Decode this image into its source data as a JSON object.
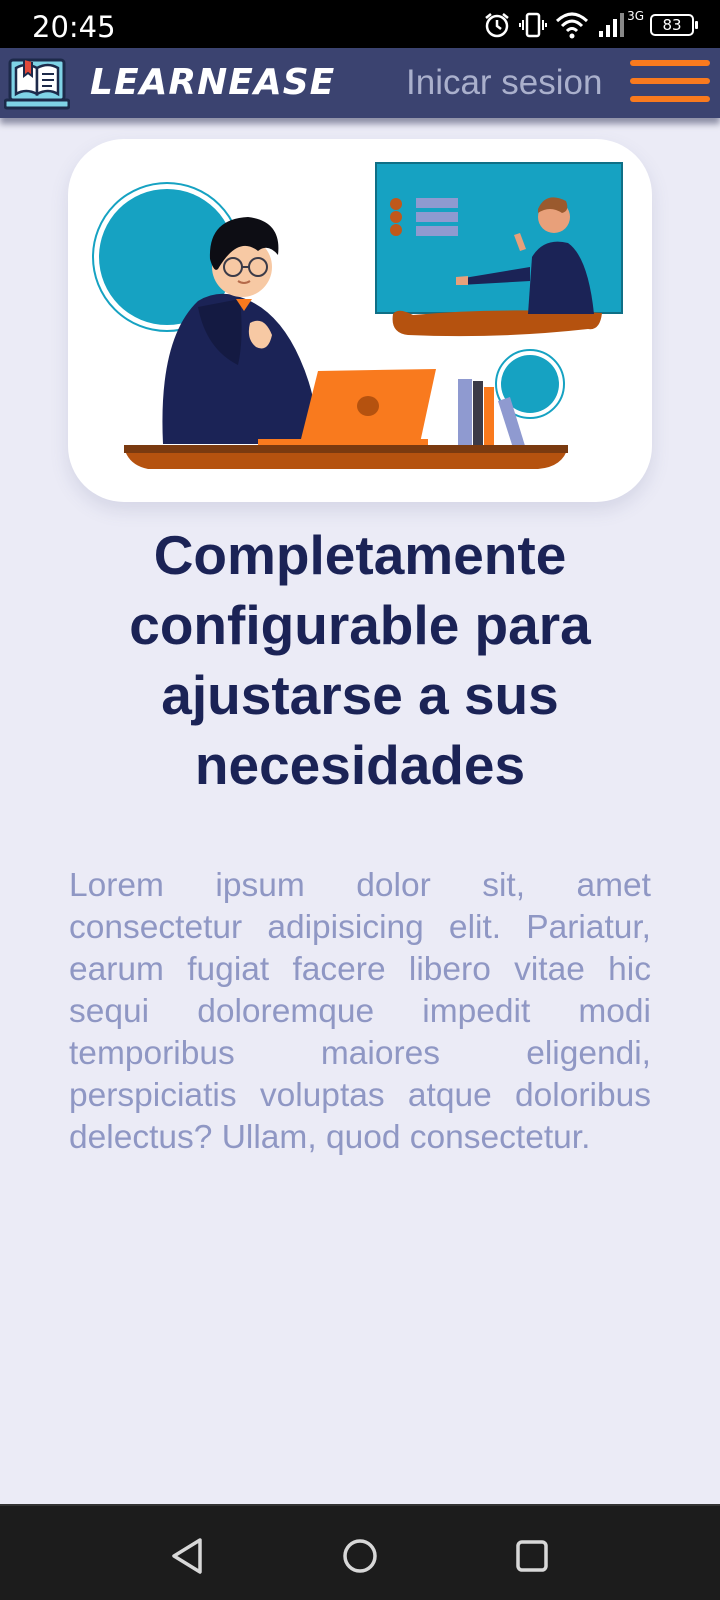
{
  "status_bar": {
    "time": "20:45",
    "network_label": "3G",
    "battery": "83",
    "icons": [
      "alarm-icon",
      "vibrate-icon",
      "wifi-icon",
      "signal-icon",
      "battery-icon"
    ]
  },
  "header": {
    "brand": "LEARNEASE",
    "login_label": "Inicar sesion",
    "menu_icon": "hamburger-menu-icon",
    "colors": {
      "bar": "#3b4370",
      "accent": "#f97a1e",
      "login": "#aab0cc"
    }
  },
  "hero": {
    "illustration": "student-online-class-illustration"
  },
  "content": {
    "headline": "Completamente configurable para ajustarse a sus necesidades",
    "body": "Lorem ipsum dolor sit, amet consectetur adipisicing elit. Pariatur, earum fugiat facere libero vitae hic sequi doloremque impedit modi temporibus maiores eligendi, perspiciatis voluptas atque doloribus delectus? Ullam, quod consectetur.",
    "colors": {
      "headline": "#1b2356",
      "body": "#8f97c4"
    }
  },
  "nav_bar": {
    "buttons": [
      "back-icon",
      "home-icon",
      "recents-icon"
    ]
  }
}
